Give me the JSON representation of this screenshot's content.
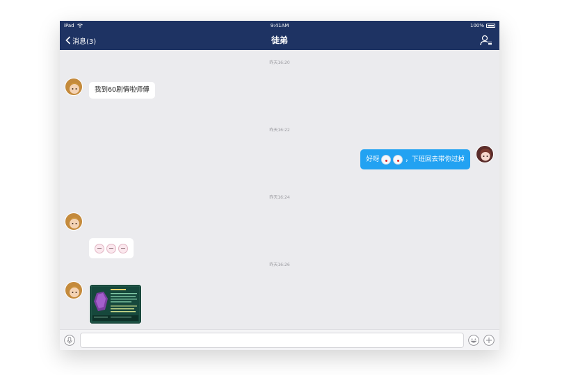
{
  "status_bar": {
    "device": "iPad",
    "wifi_icon": "wifi-icon",
    "time": "9:41AM",
    "battery": "100%",
    "battery_level": 1.0
  },
  "nav": {
    "back_label": "消息(3)",
    "title": "徒弟",
    "profile_icon": "profile-list-icon"
  },
  "messages": [
    {
      "timestamp": "昨天16:20",
      "direction": "incoming",
      "type": "text",
      "text": "我到60剧情啦师傅"
    },
    {
      "timestamp": "昨天16:22",
      "direction": "outgoing",
      "type": "text_with_emoji",
      "text_before": "好呀",
      "emoji": [
        "ghost-emoji",
        "ghost-emoji"
      ],
      "text_after": "，下班回去带你过掉"
    },
    {
      "timestamp": "昨天16:24",
      "direction": "incoming",
      "type": "emoji",
      "emoji": [
        "sleepy-face-emoji",
        "sleepy-face-emoji",
        "sleepy-face-emoji"
      ]
    },
    {
      "timestamp": "昨天16:26",
      "direction": "incoming",
      "type": "image",
      "image": "game-screenshot-thumbnail"
    }
  ],
  "input_bar": {
    "voice_icon": "microphone-icon",
    "text_value": "",
    "placeholder": "",
    "emoji_icon": "smiley-icon",
    "plus_icon": "plus-icon"
  },
  "colors": {
    "nav_bg": "#1e3363",
    "chat_bg": "#ebebee",
    "outgoing_bubble": "#22a2f2",
    "incoming_bubble": "#ffffff"
  }
}
